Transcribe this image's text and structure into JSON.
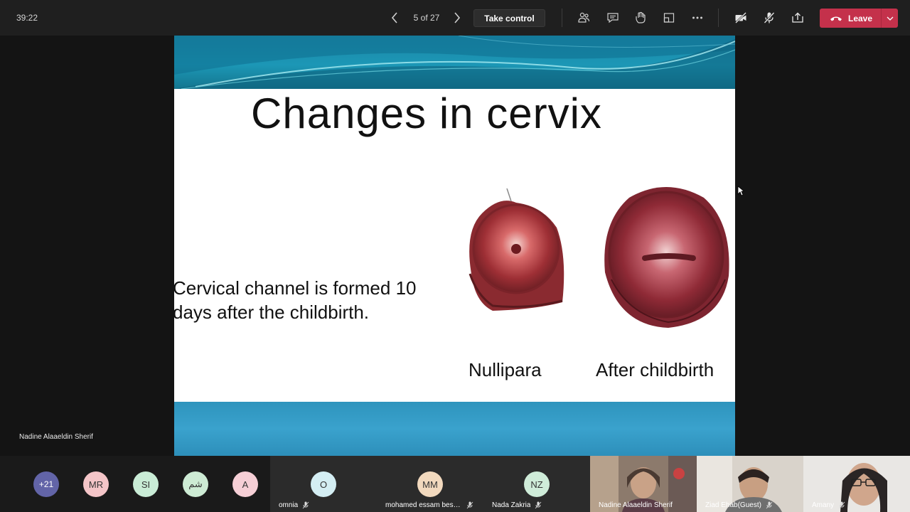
{
  "topbar": {
    "timer": "39:22",
    "page_counter": "5 of 27",
    "take_control": "Take control",
    "leave": "Leave"
  },
  "slide": {
    "title": "Changes in cervix",
    "body_line1": "Cervical channel is formed 10",
    "body_line2": "days after the childbirth.",
    "caption_left": "Nullipara",
    "caption_right": "After childbirth"
  },
  "presenter_label": "Nadine Alaaeldin Sherif",
  "participants": {
    "overflow": "+21",
    "avatars": [
      {
        "initials": "MR",
        "color": "#f4c5c8"
      },
      {
        "initials": "SI",
        "color": "#c9ecd6"
      },
      {
        "initials": "شم",
        "color": "#cdebd4"
      },
      {
        "initials": "A",
        "color": "#f6cfd6"
      }
    ],
    "tiles": [
      {
        "initials": "O",
        "name": "omnia",
        "color": "#d4eef3"
      },
      {
        "initials": "MM",
        "name": "mohamed essam besh...",
        "color": "#f2d9be"
      },
      {
        "initials": "NZ",
        "name": "Nada Zakria",
        "color": "#cfecd9"
      }
    ],
    "video_tiles": [
      {
        "name": "Nadine Alaaeldin Sherif"
      },
      {
        "name": "Ziad Ehab(Guest)"
      },
      {
        "name": "Amany"
      }
    ]
  },
  "colors": {
    "leave_red": "#c4314b",
    "overflow_purple": "#6264a7",
    "slide_header_teal": "#1c97b6",
    "slide_footer_blue": "#3aa2cd"
  }
}
